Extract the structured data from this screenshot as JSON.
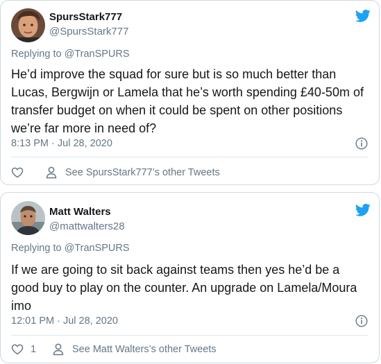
{
  "tweets": [
    {
      "display_name": "SpursStark777",
      "handle": "@SpursStark777",
      "replying_prefix": "Replying to",
      "replying_to": "@TranSPURS",
      "text": "He’d improve the squad for sure but is so much better than Lucas, Bergwijn or Lamela that he’s worth spending £40-50m of transfer budget on when it could be spent on other positions we’re far more in need of?",
      "timestamp": "8:13 PM · Jul 28, 2020",
      "like_count": "",
      "other_tweets_link": "See SpursStark777’s other Tweets"
    },
    {
      "display_name": "Matt Walters",
      "handle": "@mattwalters28",
      "replying_prefix": "Replying to",
      "replying_to": "@TranSPURS",
      "text": "If we are going to sit back against teams then yes he’d be a good buy to play on the counter. An upgrade on Lamela/Moura imo",
      "timestamp": "12:01 PM · Jul 28, 2020",
      "like_count": "1",
      "other_tweets_link": "See Matt Walters’s other Tweets"
    }
  ],
  "colors": {
    "twitter_blue": "#1da1f2",
    "text_primary": "#14171a",
    "text_secondary": "#657786",
    "border": "#cfd9de"
  },
  "icons": [
    "twitter-bird-icon",
    "info-icon",
    "heart-icon",
    "person-icon"
  ]
}
